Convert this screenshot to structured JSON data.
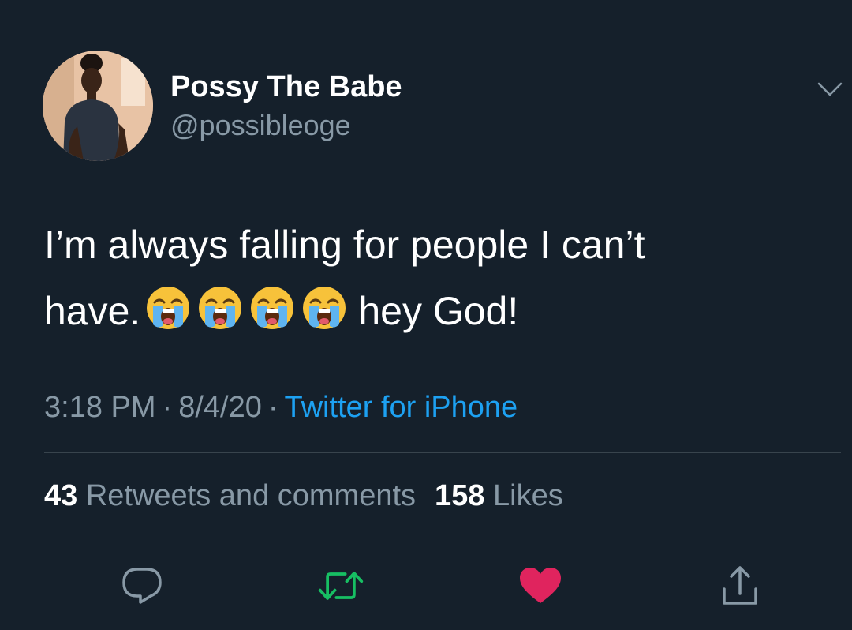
{
  "tweet": {
    "display_name": "Possy The Babe",
    "handle": "@possibleoge",
    "text_line1": "I’m always falling for people I can’t",
    "text_line2_start": "have.",
    "text_line2_end": "hey God!",
    "emojis": [
      "loudly-crying-face",
      "loudly-crying-face",
      "loudly-crying-face",
      "loudly-crying-face"
    ],
    "time": "3:18 PM",
    "date": "8/4/20",
    "separator": "·",
    "source": "Twitter for iPhone"
  },
  "stats": {
    "retweets_count": "43",
    "retweets_label": "Retweets and comments",
    "likes_count": "158",
    "likes_label": "Likes"
  },
  "actions": {
    "reply_icon": "reply-icon",
    "retweet_icon": "retweet-icon",
    "like_icon": "heart-icon",
    "share_icon": "share-icon"
  },
  "colors": {
    "background": "#15202b",
    "muted_text": "#8899a6",
    "link": "#1da1f2",
    "retweet_green": "#17bf63",
    "like_red": "#e0245e",
    "divider": "#38444d"
  }
}
